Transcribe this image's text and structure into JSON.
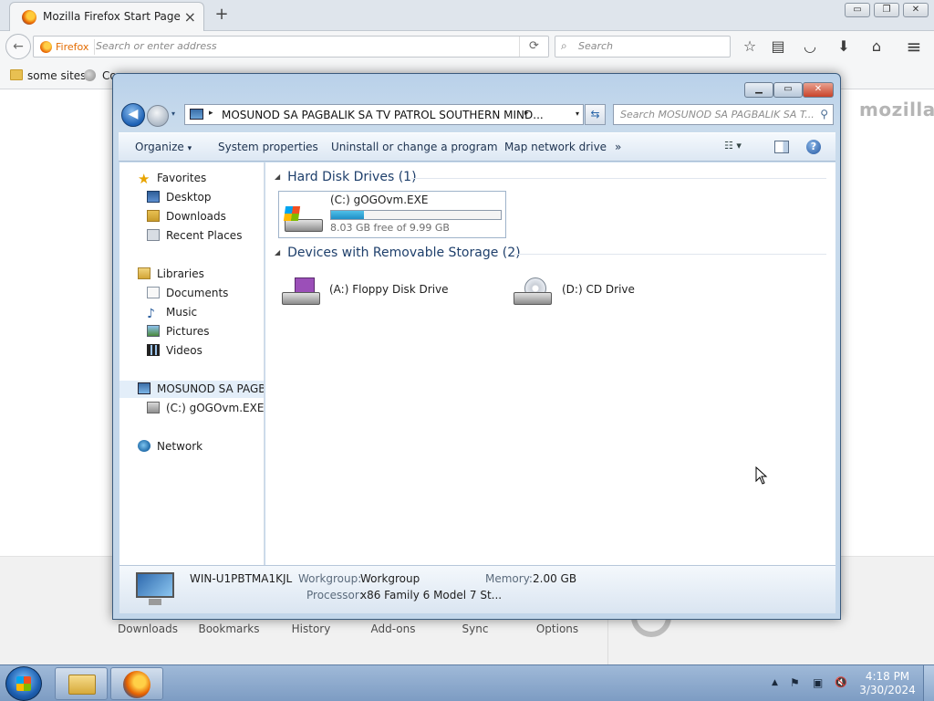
{
  "firefox": {
    "tab_title": "Mozilla Firefox Start Page",
    "tab_close": "×",
    "new_tab": "+",
    "window_buttons": {
      "minimize": "▭",
      "restore": "❐",
      "close": "✕"
    },
    "back_glyph": "←",
    "identity_label": "Firefox",
    "url_placeholder": "Search or enter address",
    "reload_glyph": "⟳",
    "search_glyph": "⌕",
    "search_placeholder": "Search",
    "toolbar_icons": [
      "star-icon",
      "reading-list-icon",
      "pocket-icon",
      "download-icon",
      "home-icon",
      "menu-icon"
    ],
    "toolbar_glyphs": {
      "star": "☆",
      "list": "▤",
      "pocket": "◡",
      "download": "⬇",
      "home": "⌂",
      "menu": "≡"
    },
    "bookmarks": [
      {
        "label": "some sites",
        "icon": "folder-icon"
      },
      {
        "label": "Co",
        "icon": "globe-icon"
      }
    ],
    "brand": "mozilla",
    "launcher": [
      "Downloads",
      "Bookmarks",
      "History",
      "Add-ons",
      "Sync",
      "Options"
    ]
  },
  "explorer": {
    "caption_buttons": {
      "minimize": "▁",
      "maximize": "▭",
      "close": "✕"
    },
    "back_glyph": "◀",
    "address_path": "MOSUNOD SA PAGBALIK SA TV PATROL SOUTHERN MIND...",
    "chevron": "▸",
    "dropdown": "▾",
    "refresh_glyph": "⇆",
    "search_placeholder": "Search MOSUNOD SA PAGBALIK SA T...",
    "search_glyph": "⚲",
    "commands": {
      "organize": "Organize",
      "organize_arrow": "▾",
      "system_properties": "System properties",
      "uninstall": "Uninstall or change a program",
      "map_drive": "Map network drive",
      "more": "»"
    },
    "views_glyph": "☷ ▾",
    "help_glyph": "?",
    "nav": {
      "favorites": "Favorites",
      "star_glyph": "★",
      "desktop": "Desktop",
      "downloads": "Downloads",
      "recent_places": "Recent Places",
      "libraries": "Libraries",
      "documents": "Documents",
      "music": "Music",
      "music_glyph": "♪",
      "pictures": "Pictures",
      "videos": "Videos",
      "computer": "MOSUNOD SA PAGBALIK SA TV PATROL SOUTHERN MIND",
      "drive_c": "(C:) gOGOvm.EXE",
      "network": "Network"
    },
    "groups": {
      "hdd_header": "Hard Disk Drives (1)",
      "removable_header": "Devices with Removable Storage (2)",
      "triangle": "◢"
    },
    "drives": {
      "c": {
        "name": "(C:) gOGOvm.EXE",
        "free_text": "8.03 GB free of 9.99 GB",
        "used_fraction": 0.196
      },
      "a": {
        "name": "(A:) Floppy Disk Drive"
      },
      "d": {
        "name": "(D:) CD Drive"
      }
    },
    "details": {
      "computer_name": "WIN-U1PBTMA1KJL",
      "workgroup_label": "Workgroup:",
      "workgroup_value": "Workgroup",
      "memory_label": "Memory:",
      "memory_value": "2.00 GB",
      "processor_label": "Processor:",
      "processor_value": "x86 Family 6 Model 7 St..."
    }
  },
  "taskbar": {
    "apps": [
      "windows-explorer-icon",
      "firefox-icon"
    ],
    "tray": {
      "up_arrow": "▲",
      "flag": "⚑",
      "network": "▣",
      "volume": "🔇"
    },
    "time": "4:18 PM",
    "date": "3/30/2024"
  },
  "colors": {
    "explorer_frame": "#c2d6ea",
    "close_red": "#c8432a",
    "usage_bar": "#1f8fc7",
    "taskbar": "#7d9cc3"
  }
}
